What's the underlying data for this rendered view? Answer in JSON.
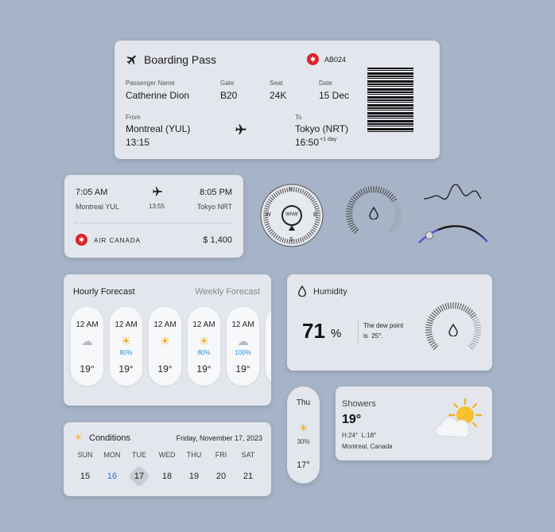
{
  "boarding": {
    "title": "Boarding Pass",
    "flight": "AB024",
    "passenger_label": "Passenger Name",
    "passenger": "Catherine Dion",
    "gate_label": "Gate",
    "gate": "B20",
    "seat_label": "Seat",
    "seat": "24K",
    "date_label": "Date",
    "date": "15 Dec",
    "from_label": "From",
    "from": "Montreal (YUL)",
    "depart": "13:15",
    "to_label": "To",
    "to": "Tokyo (NRT)",
    "arrive": "16:50",
    "arrive_note": "+1 day"
  },
  "flight_card": {
    "dep_time": "7:05 AM",
    "arr_time": "8:05 PM",
    "origin": "Montreal YUL",
    "duration": "13:55",
    "destination": "Tokyo NRT",
    "airline": "AIR CANADA",
    "price": "$ 1,400"
  },
  "compass": {
    "n": "N",
    "s": "S",
    "e": "E",
    "w": "W",
    "direction": "WNW"
  },
  "forecast": {
    "tab_active": "Hourly Forecast",
    "tab_inactive": "Weekly Forecast",
    "hours": [
      {
        "time": "12 AM",
        "icon": "cloud-icon",
        "precip": "",
        "temp": "19°"
      },
      {
        "time": "12 AM",
        "icon": "rain-sun-icon",
        "precip": "80%",
        "temp": "19°"
      },
      {
        "time": "12 AM",
        "icon": "sun-icon",
        "precip": "",
        "temp": "19°"
      },
      {
        "time": "12 AM",
        "icon": "rain-sun-icon",
        "precip": "80%",
        "temp": "19°"
      },
      {
        "time": "12 AM",
        "icon": "rain-icon",
        "precip": "100%",
        "temp": "19°"
      }
    ]
  },
  "humidity": {
    "title": "Humidity",
    "value": "71",
    "unit": "%",
    "dew_text_1": "The dew point",
    "dew_text_2": "is  25°.",
    "level": 0.71
  },
  "day_pill": {
    "day": "Thu",
    "precip": "30%",
    "temp": "17°"
  },
  "showers": {
    "title": "Showers",
    "temp": "19°",
    "hilo": "H:24°  L:18°",
    "location": "Montreal, Canada"
  },
  "conditions": {
    "title": "Conditions",
    "date": "Friday, November 17, 2023",
    "days": [
      "SUN",
      "MON",
      "TUE",
      "WED",
      "THU",
      "FRI",
      "SAT"
    ],
    "dates": [
      "15",
      "16",
      "17",
      "18",
      "19",
      "20",
      "21"
    ]
  },
  "colors": {
    "background": "#a7b3c6",
    "card": "#e3e6ec",
    "airline_red": "#d8232a",
    "accent_blue": "#2a8fd6",
    "slider_purple": "#5b4fd6",
    "sun": "#f2b01e"
  }
}
